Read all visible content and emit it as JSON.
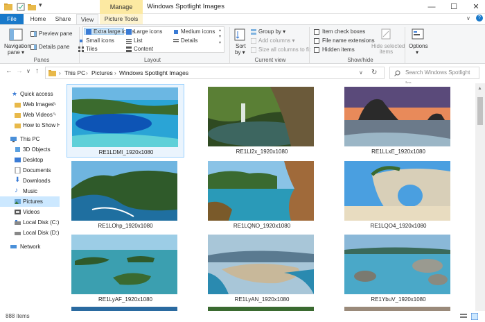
{
  "titlebar": {
    "manage_label": "Manage",
    "window_title": "Windows Spotlight Images",
    "minimize": "—",
    "maximize": "☐",
    "close": "✕"
  },
  "tabs": {
    "file": "File",
    "home": "Home",
    "share": "Share",
    "view": "View",
    "picture_tools": "Picture Tools"
  },
  "ribbon": {
    "panes": {
      "navigation_pane": "Navigation",
      "navigation_pane_2": "pane ▾",
      "preview_pane": "Preview pane",
      "details_pane": "Details pane",
      "group_label": "Panes"
    },
    "layout": {
      "extra_large_icons": "Extra large icons",
      "large_icons": "Large icons",
      "medium_icons": "Medium icons",
      "small_icons": "Small icons",
      "list": "List",
      "details": "Details",
      "tiles": "Tiles",
      "content": "Content",
      "group_label": "Layout"
    },
    "current_view": {
      "sort_by": "Sort",
      "sort_by_2": "by ▾",
      "group_by": "Group by ▾",
      "add_columns": "Add columns ▾",
      "size_columns": "Size all columns to fit",
      "group_label": "Current view"
    },
    "show_hide": {
      "item_check_boxes": "Item check boxes",
      "file_name_extensions": "File name extensions",
      "hidden_items": "Hidden items",
      "hide_selected": "Hide selected",
      "hide_selected_2": "items",
      "group_label": "Show/hide"
    },
    "options": "Options",
    "options_arrow": "▾"
  },
  "address": {
    "back": "←",
    "forward": "→",
    "dropdown": "∨",
    "up": "↑",
    "crumbs": [
      "This PC",
      "Pictures",
      "Windows Spotlight Images"
    ],
    "sep": "›",
    "refresh": "↻",
    "search_placeholder": "Search Windows Spotlight Im..."
  },
  "nav": {
    "quick_access": "Quick access",
    "web_images": "Web Images",
    "web_videos": "Web Videos",
    "how_to_show": "How to Show H",
    "this_pc": "This PC",
    "objects_3d": "3D Objects",
    "desktop": "Desktop",
    "documents": "Documents",
    "downloads": "Downloads",
    "music": "Music",
    "pictures": "Pictures",
    "videos": "Videos",
    "local_c": "Local Disk (C:)",
    "local_d": "Local Disk (D:)",
    "network": "Network"
  },
  "files": [
    {
      "name": "RE1LDMI_1920x1080"
    },
    {
      "name": "RE1LI2x_1920x1080"
    },
    {
      "name": "RE1LLxE_1920x1080"
    },
    {
      "name": "RE1LOhp_1920x1080"
    },
    {
      "name": "RE1LQNO_1920x1080"
    },
    {
      "name": "RE1LQO4_1920x1080"
    },
    {
      "name": "RE1LyAF_1920x1080"
    },
    {
      "name": "RE1LyAN_1920x1080"
    },
    {
      "name": "RE1YbuV_1920x1080"
    }
  ],
  "status": {
    "item_count": "888 items"
  },
  "colors": {
    "accent": "#1979ca",
    "selection": "#cce8ff",
    "manage_tab": "#fce9a2"
  }
}
